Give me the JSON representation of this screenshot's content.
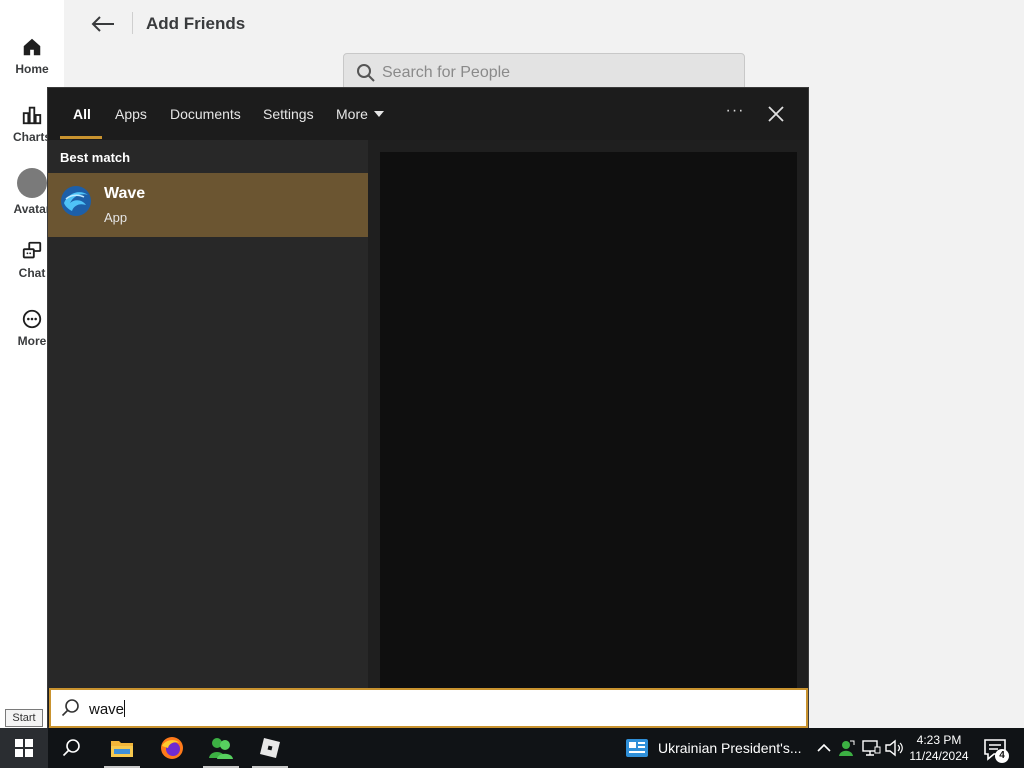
{
  "app": {
    "nav": [
      {
        "label": "Home",
        "icon": "home-icon"
      },
      {
        "label": "Charts",
        "icon": "charts-icon"
      },
      {
        "label": "Avatar",
        "icon": "avatar-icon"
      },
      {
        "label": "Chat",
        "icon": "chat-icon"
      },
      {
        "label": "More",
        "icon": "more-icon"
      }
    ],
    "page_title": "Add Friends",
    "people_search_placeholder": "Search for People"
  },
  "search_panel": {
    "tabs": [
      {
        "label": "All",
        "active": true
      },
      {
        "label": "Apps"
      },
      {
        "label": "Documents"
      },
      {
        "label": "Settings"
      },
      {
        "label": "More"
      }
    ],
    "best_match_label": "Best match",
    "best_match": {
      "name": "Wave",
      "type": "App",
      "icon": "wave-app-icon"
    },
    "query": "wave"
  },
  "tooltip": "Start",
  "taskbar": {
    "apps": [
      "file-explorer-icon",
      "firefox-icon",
      "people-app-icon",
      "roblox-icon"
    ],
    "news_text": "Ukrainian President's...",
    "time": "4:23 PM",
    "date": "11/24/2024",
    "notification_count": "4"
  },
  "colors": {
    "accent": "#c9932f",
    "best_match_bg": "#6b5531",
    "panel_bg": "#1f1f1f",
    "taskbar_bg": "#101316"
  }
}
